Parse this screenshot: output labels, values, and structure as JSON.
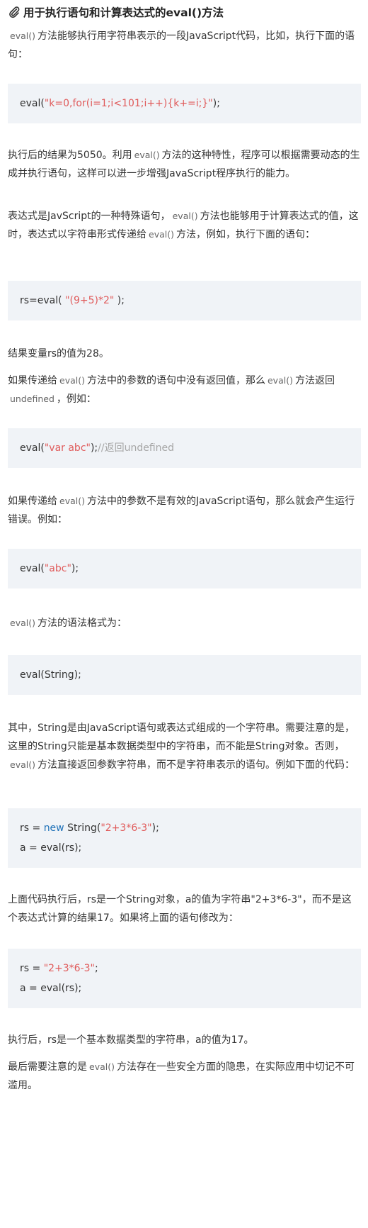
{
  "title": "用于执行语句和计算表达式的eval()方法",
  "p1": {
    "code": "eval()",
    "text": "方法能够执行用字符串表示的一段JavaScript代码，比如，执行下面的语句："
  },
  "code1": {
    "pre": "eval(",
    "str": "\"k=0,for(i=1;i<101;i++){k+=i;}\"",
    "post": ");"
  },
  "p2": {
    "a": "执行后的结果为5050。利用",
    "code": "eval()",
    "b": "方法的这种特性，程序可以根据需要动态的生成并执行语句，这样可以进一步增强JavaScript程序执行的能力。"
  },
  "p3": {
    "a": "表达式是JavScript的一种特殊语句，",
    "code1": "eval()",
    "b": "方法也能够用于计算表达式的值，这时，表达式以字符串形式传递给",
    "code2": "eval()",
    "c": "方法，例如，执行下面的语句："
  },
  "code2": {
    "pre": "rs=eval( ",
    "str": "\"(9+5)*2\"",
    "post": " );"
  },
  "p4": "结果变量rs的值为28。",
  "p5": {
    "a": "如果传递给",
    "code1": "eval()",
    "b": "方法中的参数的语句中没有返回值，那么",
    "code2": "eval()",
    "c": "方法返回",
    "code3": "undefined",
    "d": "，例如："
  },
  "code3": {
    "pre": "eval(",
    "str": "\"var abc\"",
    "post": ");",
    "comment": "//返回undefined"
  },
  "p6": {
    "a": "如果传递给",
    "code": "eval()",
    "b": "方法中的参数不是有效的JavaScript语句，那么就会产生运行错误。例如："
  },
  "code4": {
    "pre": "eval(",
    "str": "\"abc\"",
    "post": ");"
  },
  "p7": {
    "code": "eval()",
    "text": "方法的语法格式为："
  },
  "code5": "eval(String);",
  "p8": {
    "a": "其中，String是由JavaScript语句或表达式组成的一个字符串。需要注意的是，这里的String只能是基本数据类型中的字符串，而不能是String对象。否则，",
    "code": "eval()",
    "b": "方法直接返回参数字符串，而不是字符串表示的语句。例如下面的代码："
  },
  "code6": {
    "line1_pre": "rs = ",
    "line1_kw": "new",
    "line1_mid": " String(",
    "line1_str": "\"2+3*6-3\"",
    "line1_post": ");",
    "line2": "a = eval(rs);"
  },
  "p9": "上面代码执行后，rs是一个String对象，a的值为字符串\"2+3*6-3\"，而不是这个表达式计算的结果17。如果将上面的语句修改为：",
  "code7": {
    "line1_pre": "rs = ",
    "line1_str": "\"2+3*6-3\"",
    "line1_post": ";",
    "line2": "a = eval(rs);"
  },
  "p10": "执行后，rs是一个基本数据类型的字符串，a的值为17。",
  "p11": {
    "a": "最后需要注意的是",
    "code": "eval()",
    "b": "方法存在一些安全方面的隐患，在实际应用中切记不可滥用。"
  },
  "colors": {
    "code_bg": "#f0f3f7",
    "string": "#e05b5b",
    "keyword": "#1f71b8",
    "comment": "#a6a6a6",
    "text": "#333333"
  }
}
